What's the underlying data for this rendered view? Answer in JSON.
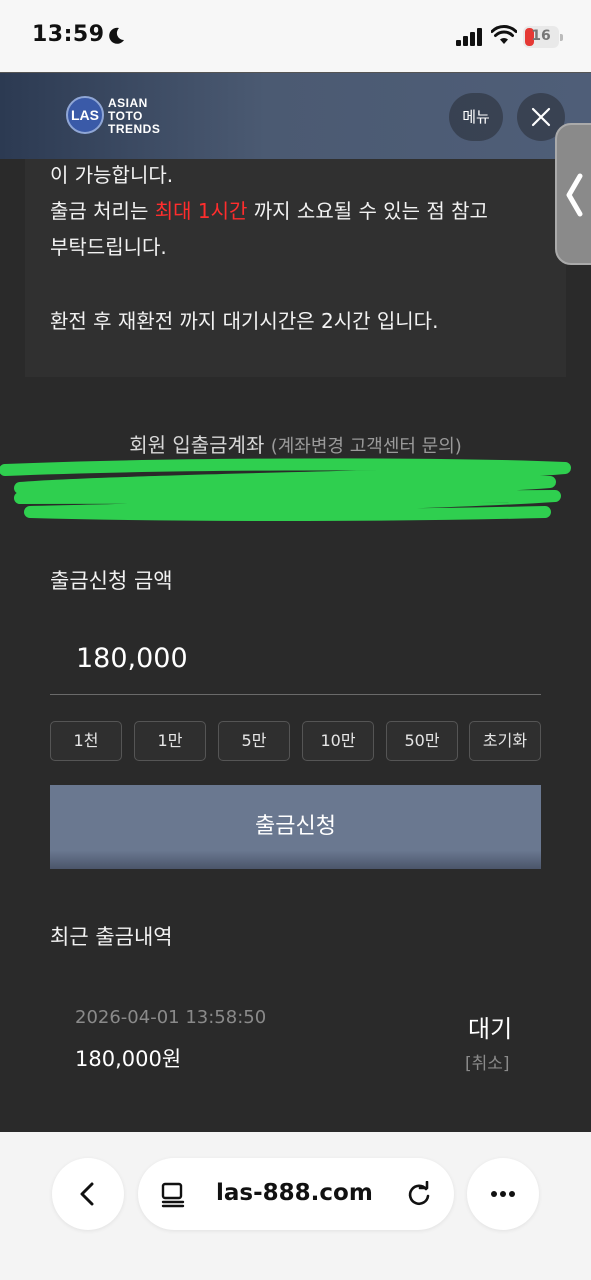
{
  "status_bar": {
    "time": "13:59",
    "battery": "16"
  },
  "header": {
    "logo_badge": "LAS",
    "logo_lines": [
      "ASIAN",
      "TOTO",
      "TRENDS"
    ],
    "menu_label": "메뉴"
  },
  "notice": {
    "line1": "이 가능합니다.",
    "line2_a": "출금 처리는 ",
    "line2_red": "최대 1시간",
    "line2_b": " 까지 소요될 수 있는 점 참고",
    "line3": "부탁드립니다.",
    "line4": "환전 후 재환전 까지 대기시간은 2시간 입니다."
  },
  "account": {
    "title": "회원 입출금계좌",
    "subtitle": "(계좌변경 고객센터 문의)"
  },
  "withdraw": {
    "amount_label": "출금신청 금액",
    "amount_value": "180,000",
    "quick_buttons": [
      "1천",
      "1만",
      "5만",
      "10만",
      "50만",
      "초기화"
    ],
    "submit_label": "출금신청"
  },
  "history": {
    "title": "최근 출금내역",
    "items": [
      {
        "datetime": "2026-04-01 13:58:50",
        "amount": "180,000원",
        "status": "대기",
        "cancel": "[취소]"
      }
    ]
  },
  "browser": {
    "url": "las-888.com"
  },
  "colors": {
    "accent_red": "#ff2d2d",
    "submit_bg": "#6a7890",
    "header_bg": "#4b5a72"
  }
}
